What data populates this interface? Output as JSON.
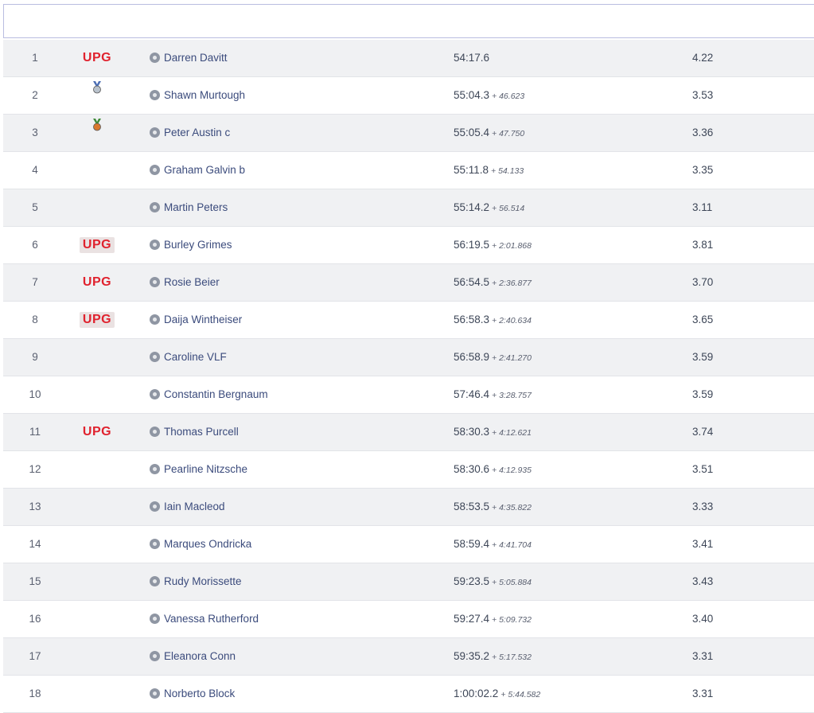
{
  "colors": {
    "accent_red": "#e0222e",
    "row_alt": "#f0f1f3",
    "link": "#3b4b7c"
  },
  "rows": [
    {
      "pos": "1",
      "badge": "upg",
      "badge_text": "UPG",
      "boxed": false,
      "name": "Darren Davitt",
      "time": "54:17.6",
      "gap": "",
      "score": "4.22"
    },
    {
      "pos": "2",
      "badge": "silver-medal",
      "badge_text": "",
      "boxed": false,
      "name": "Shawn Murtough",
      "time": "55:04.3",
      "gap": "+ 46.623",
      "score": "3.53"
    },
    {
      "pos": "3",
      "badge": "bronze-medal",
      "badge_text": "",
      "boxed": false,
      "name": "Peter Austin c",
      "time": "55:05.4",
      "gap": "+ 47.750",
      "score": "3.36"
    },
    {
      "pos": "4",
      "badge": "",
      "badge_text": "",
      "boxed": false,
      "name": "Graham Galvin b",
      "time": "55:11.8",
      "gap": "+ 54.133",
      "score": "3.35"
    },
    {
      "pos": "5",
      "badge": "",
      "badge_text": "",
      "boxed": false,
      "name": "Martin Peters",
      "time": "55:14.2",
      "gap": "+ 56.514",
      "score": "3.11"
    },
    {
      "pos": "6",
      "badge": "upg",
      "badge_text": "UPG",
      "boxed": true,
      "name": "Burley Grimes",
      "time": "56:19.5",
      "gap": "+ 2:01.868",
      "score": "3.81"
    },
    {
      "pos": "7",
      "badge": "upg",
      "badge_text": "UPG",
      "boxed": false,
      "name": "Rosie Beier",
      "time": "56:54.5",
      "gap": "+ 2:36.877",
      "score": "3.70"
    },
    {
      "pos": "8",
      "badge": "upg",
      "badge_text": "UPG",
      "boxed": true,
      "name": "Daija Wintheiser",
      "time": "56:58.3",
      "gap": "+ 2:40.634",
      "score": "3.65"
    },
    {
      "pos": "9",
      "badge": "",
      "badge_text": "",
      "boxed": false,
      "name": "Caroline VLF",
      "time": "56:58.9",
      "gap": "+ 2:41.270",
      "score": "3.59"
    },
    {
      "pos": "10",
      "badge": "",
      "badge_text": "",
      "boxed": false,
      "name": "Constantin Bergnaum",
      "time": "57:46.4",
      "gap": "+ 3:28.757",
      "score": "3.59"
    },
    {
      "pos": "11",
      "badge": "upg",
      "badge_text": "UPG",
      "boxed": false,
      "name": "Thomas Purcell",
      "time": "58:30.3",
      "gap": "+ 4:12.621",
      "score": "3.74"
    },
    {
      "pos": "12",
      "badge": "",
      "badge_text": "",
      "boxed": false,
      "name": "Pearline Nitzsche",
      "time": "58:30.6",
      "gap": "+ 4:12.935",
      "score": "3.51"
    },
    {
      "pos": "13",
      "badge": "",
      "badge_text": "",
      "boxed": false,
      "name": "Iain Macleod",
      "time": "58:53.5",
      "gap": "+ 4:35.822",
      "score": "3.33"
    },
    {
      "pos": "14",
      "badge": "",
      "badge_text": "",
      "boxed": false,
      "name": "Marques Ondricka",
      "time": "58:59.4",
      "gap": "+ 4:41.704",
      "score": "3.41"
    },
    {
      "pos": "15",
      "badge": "",
      "badge_text": "",
      "boxed": false,
      "name": "Rudy Morissette",
      "time": "59:23.5",
      "gap": "+ 5:05.884",
      "score": "3.43"
    },
    {
      "pos": "16",
      "badge": "",
      "badge_text": "",
      "boxed": false,
      "name": "Vanessa Rutherford",
      "time": "59:27.4",
      "gap": "+ 5:09.732",
      "score": "3.40"
    },
    {
      "pos": "17",
      "badge": "",
      "badge_text": "",
      "boxed": false,
      "name": "Eleanora Conn",
      "time": "59:35.2",
      "gap": "+ 5:17.532",
      "score": "3.31"
    },
    {
      "pos": "18",
      "badge": "",
      "badge_text": "",
      "boxed": false,
      "name": "Norberto Block",
      "time": "1:00:02.2",
      "gap": "+ 5:44.582",
      "score": "3.31"
    }
  ]
}
